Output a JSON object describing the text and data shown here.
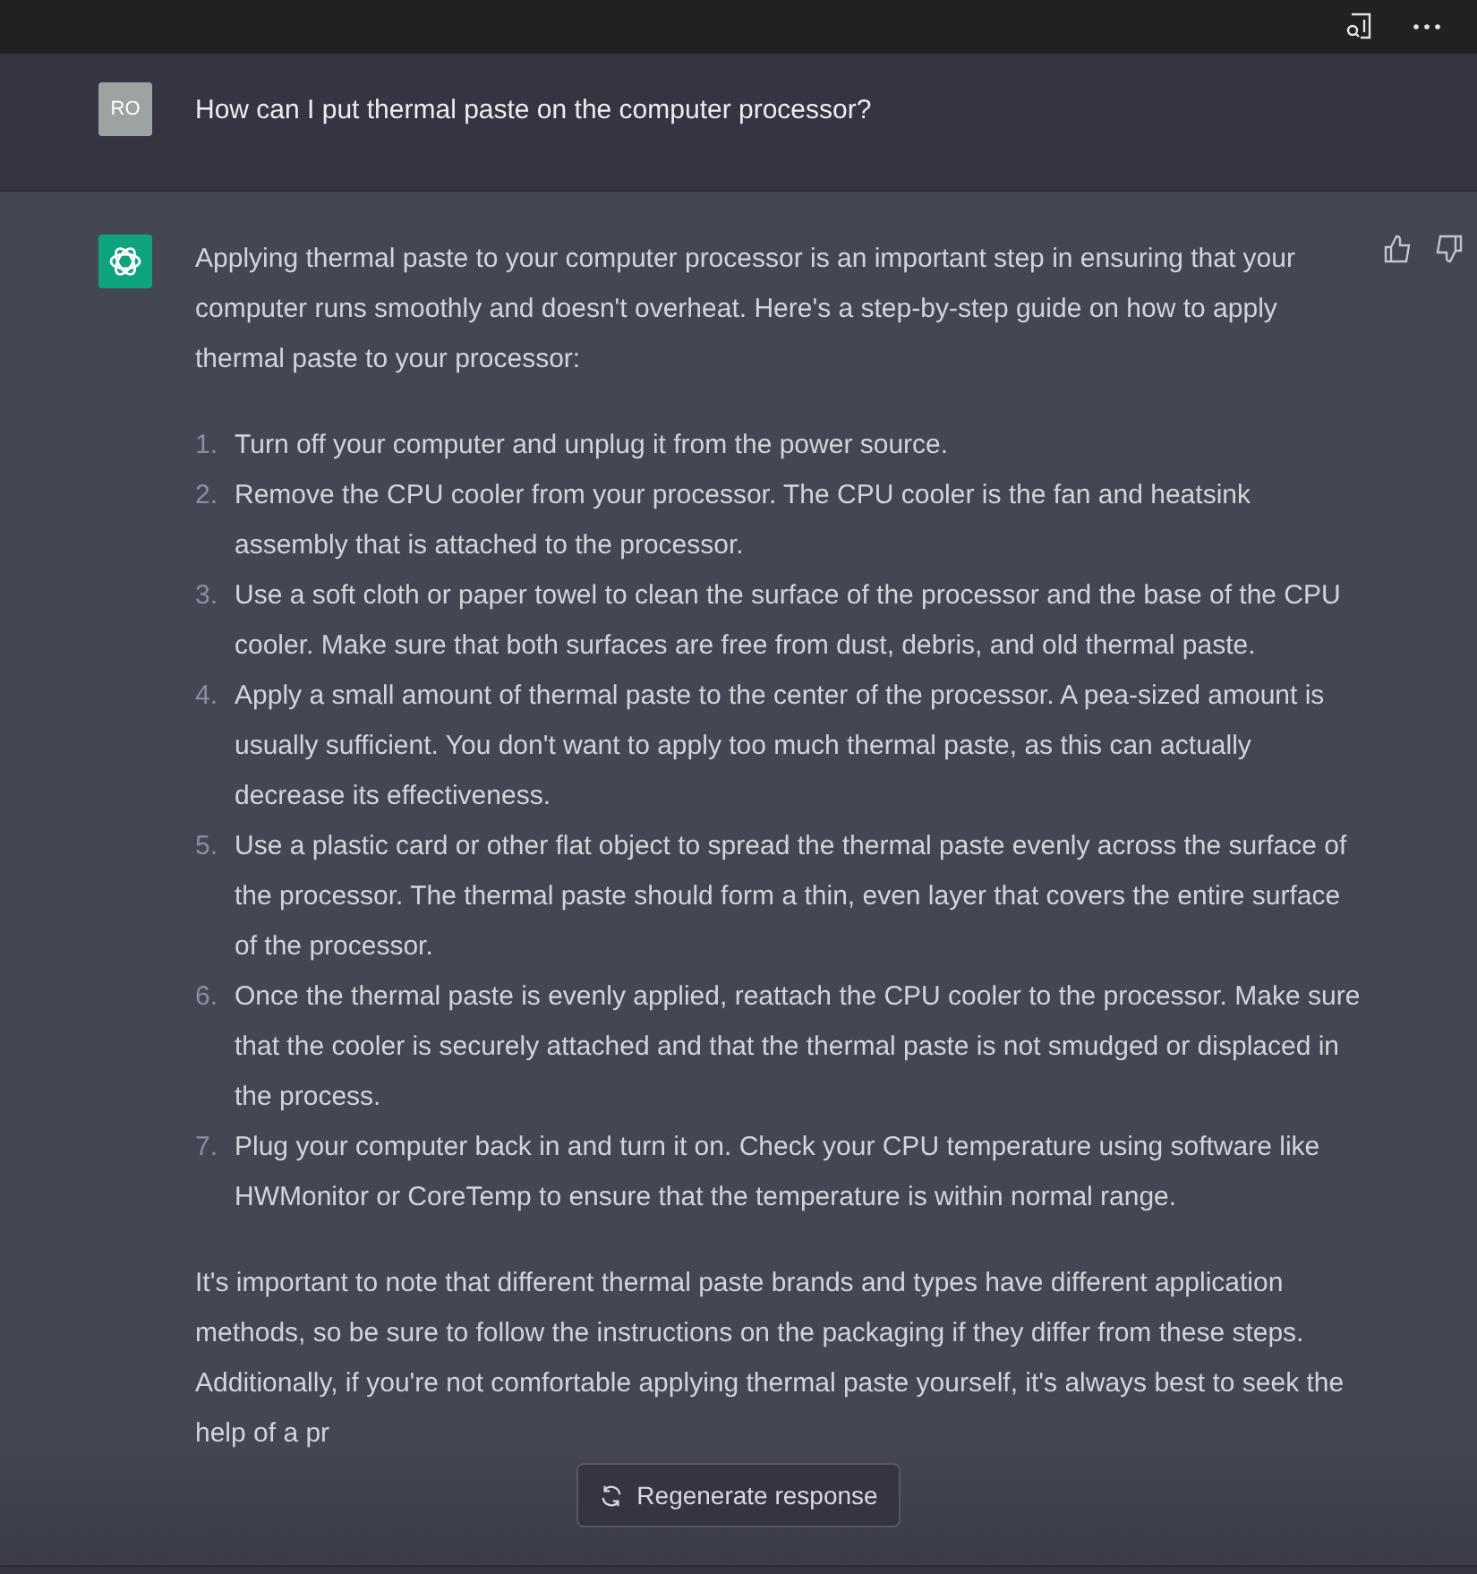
{
  "user_message": {
    "avatar": "RO",
    "text": "How can I put thermal paste on the computer processor?"
  },
  "assistant_message": {
    "intro": "Applying thermal paste to your computer processor is an important step in ensuring that your computer runs smoothly and doesn't overheat. Here's a step-by-step guide on how to apply thermal paste to your processor:",
    "steps": [
      {
        "number": "1.",
        "text": "Turn off your computer and unplug it from the power source."
      },
      {
        "number": "2.",
        "text": "Remove the CPU cooler from your processor. The CPU cooler is the fan and heatsink assembly that is attached to the processor."
      },
      {
        "number": "3.",
        "text": "Use a soft cloth or paper towel to clean the surface of the processor and the base of the CPU cooler. Make sure that both surfaces are free from dust, debris, and old thermal paste."
      },
      {
        "number": "4.",
        "text": "Apply a small amount of thermal paste to the center of the processor. A pea-sized amount is usually sufficient. You don't want to apply too much thermal paste, as this can actually decrease its effectiveness."
      },
      {
        "number": "5.",
        "text": "Use a plastic card or other flat object to spread the thermal paste evenly across the surface of the processor. The thermal paste should form a thin, even layer that covers the entire surface of the processor."
      },
      {
        "number": "6.",
        "text": "Once the thermal paste is evenly applied, reattach the CPU cooler to the processor. Make sure that the cooler is securely attached and that the thermal paste is not smudged or displaced in the process."
      },
      {
        "number": "7.",
        "text": "Plug your computer back in and turn it on. Check your CPU temperature using software like HWMonitor or CoreTemp to ensure that the temperature is within normal range."
      }
    ],
    "closing": "It's important to note that different thermal paste brands and types have different application methods, so be sure to follow the instructions on the packaging if they differ from these steps. Additionally, if you're not comfortable applying thermal paste yourself, it's always best to seek the help of a pr"
  },
  "regenerate_button": {
    "label": "Regenerate response"
  }
}
